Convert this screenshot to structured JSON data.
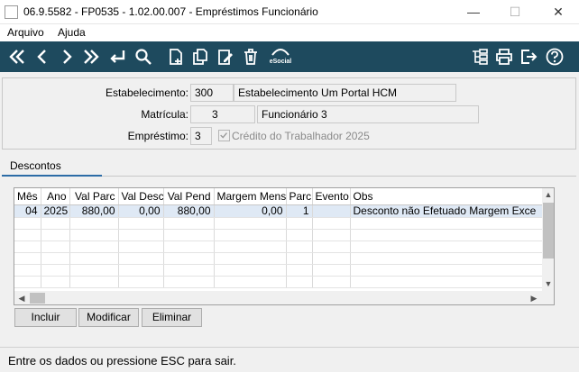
{
  "window": {
    "title": "06.9.5582 - FP0535 - 1.02.00.007 - Empréstimos Funcionário",
    "minimize_symbol": "—",
    "maximize_symbol": "☐",
    "close_symbol": "✕"
  },
  "menu": {
    "items": [
      "Arquivo",
      "Ajuda"
    ]
  },
  "toolbar": {
    "left_icons": [
      "first-record-icon",
      "previous-record-icon",
      "next-record-icon",
      "last-record-icon",
      "return-icon",
      "search-icon",
      "new-document-icon",
      "copy-document-icon",
      "edit-document-icon",
      "delete-icon",
      "esocial-icon"
    ],
    "esocial_label": "eSocial",
    "right_icons": [
      "structure-tree-icon",
      "print-icon",
      "exit-icon",
      "help-icon"
    ]
  },
  "form": {
    "estabelecimento_label": "Estabelecimento:",
    "estabelecimento_code": "300",
    "estabelecimento_name": "Estabelecimento Um Portal HCM",
    "matricula_label": "Matrícula:",
    "matricula_code": "3",
    "matricula_name": "Funcionário 3",
    "emprestimo_label": "Empréstimo:",
    "emprestimo_code": "3",
    "emprestimo_checked": true,
    "emprestimo_desc": "Crédito do Trabalhador 2025"
  },
  "tabs": [
    {
      "label": "Descontos",
      "active": true
    }
  ],
  "grid": {
    "columns": [
      "Mês",
      "Ano",
      "Val Parc",
      "Val Desc",
      "Val Pend",
      "Margem Mensal",
      "Parc",
      "Evento",
      "Obs"
    ],
    "rows": [
      [
        "04",
        "2025",
        "880,00",
        "0,00",
        "880,00",
        "0,00",
        "1",
        "",
        "Desconto não Efetuado Margem Exce"
      ]
    ]
  },
  "buttons": {
    "incluir": "Incluir",
    "modificar": "Modificar",
    "eliminar": "Eliminar"
  },
  "status": {
    "text": "Entre os dados ou pressione ESC para sair."
  },
  "colors": {
    "toolbar_bg": "#1e4a5e",
    "tab_accent": "#2c6ca6",
    "selected_row": "#dfe9f5"
  }
}
